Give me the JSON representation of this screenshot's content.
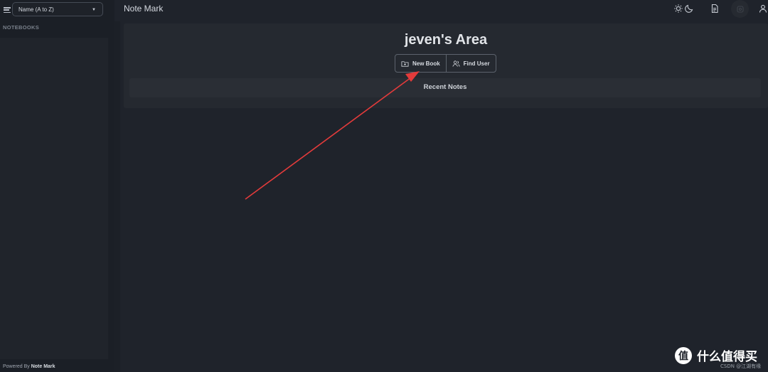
{
  "header": {
    "app_title": "Note Mark",
    "theme_icons": [
      "sun-icon",
      "moon-icon"
    ],
    "right_icons": [
      "document-icon",
      "settings-icon",
      "user-icon"
    ]
  },
  "sidebar": {
    "sort_select": {
      "value": "Name (A to Z)"
    },
    "notebooks_header": "NOTEBOOKS",
    "powered_prefix": "Powered By",
    "powered_brand": "Note Mark"
  },
  "main": {
    "area_title": "jeven's Area",
    "buttons": [
      {
        "label": "New Book",
        "icon": "folder-plus-icon"
      },
      {
        "label": "Find User",
        "icon": "users-icon"
      }
    ],
    "recent_notes_title": "Recent Notes"
  },
  "annotation": {
    "arrow_color": "#e33b3b"
  },
  "watermark": {
    "logo_text": "值",
    "site_name": "什么值得买",
    "small_text": "CSDN @江湖有缘"
  }
}
